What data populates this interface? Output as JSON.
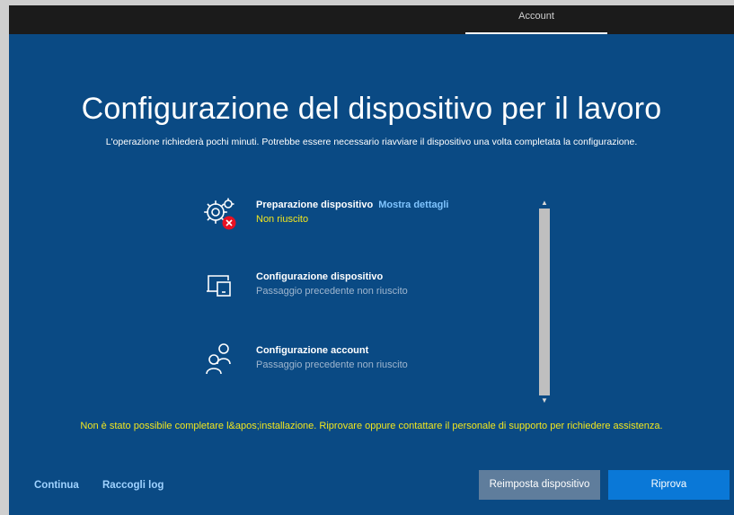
{
  "header": {
    "tab_label": "Account"
  },
  "page": {
    "title": "Configurazione del dispositivo per il lavoro",
    "subtitle": "L'operazione richiederà pochi minuti. Potrebbe essere necessario riavviare il dispositivo una volta completata la configurazione."
  },
  "steps": [
    {
      "name": "Preparazione dispositivo",
      "link": "Mostra dettagli",
      "status": "Non riuscito",
      "icon": "gears-error-icon"
    },
    {
      "name": "Configurazione dispositivo",
      "status": "Passaggio precedente non riuscito",
      "icon": "device-icon"
    },
    {
      "name": "Configurazione account",
      "status": "Passaggio precedente non riuscito",
      "icon": "accounts-icon"
    }
  ],
  "error_message": "Non è stato possibile completare l&apos;installazione. Riprovare oppure contattare il personale di supporto per richiedere assistenza.",
  "footer": {
    "continue_label": "Continua",
    "logs_label": "Raccogli log",
    "reset_label": "Reimposta dispositivo",
    "retry_label": "Riprova"
  },
  "colors": {
    "background": "#0a4a84",
    "topbar": "#1b1b1b",
    "failure_text": "#f2e61e",
    "link": "#7fc4ff",
    "primary_button": "#0a78d7",
    "secondary_button": "#5f7d9c",
    "error_badge": "#e81123"
  }
}
